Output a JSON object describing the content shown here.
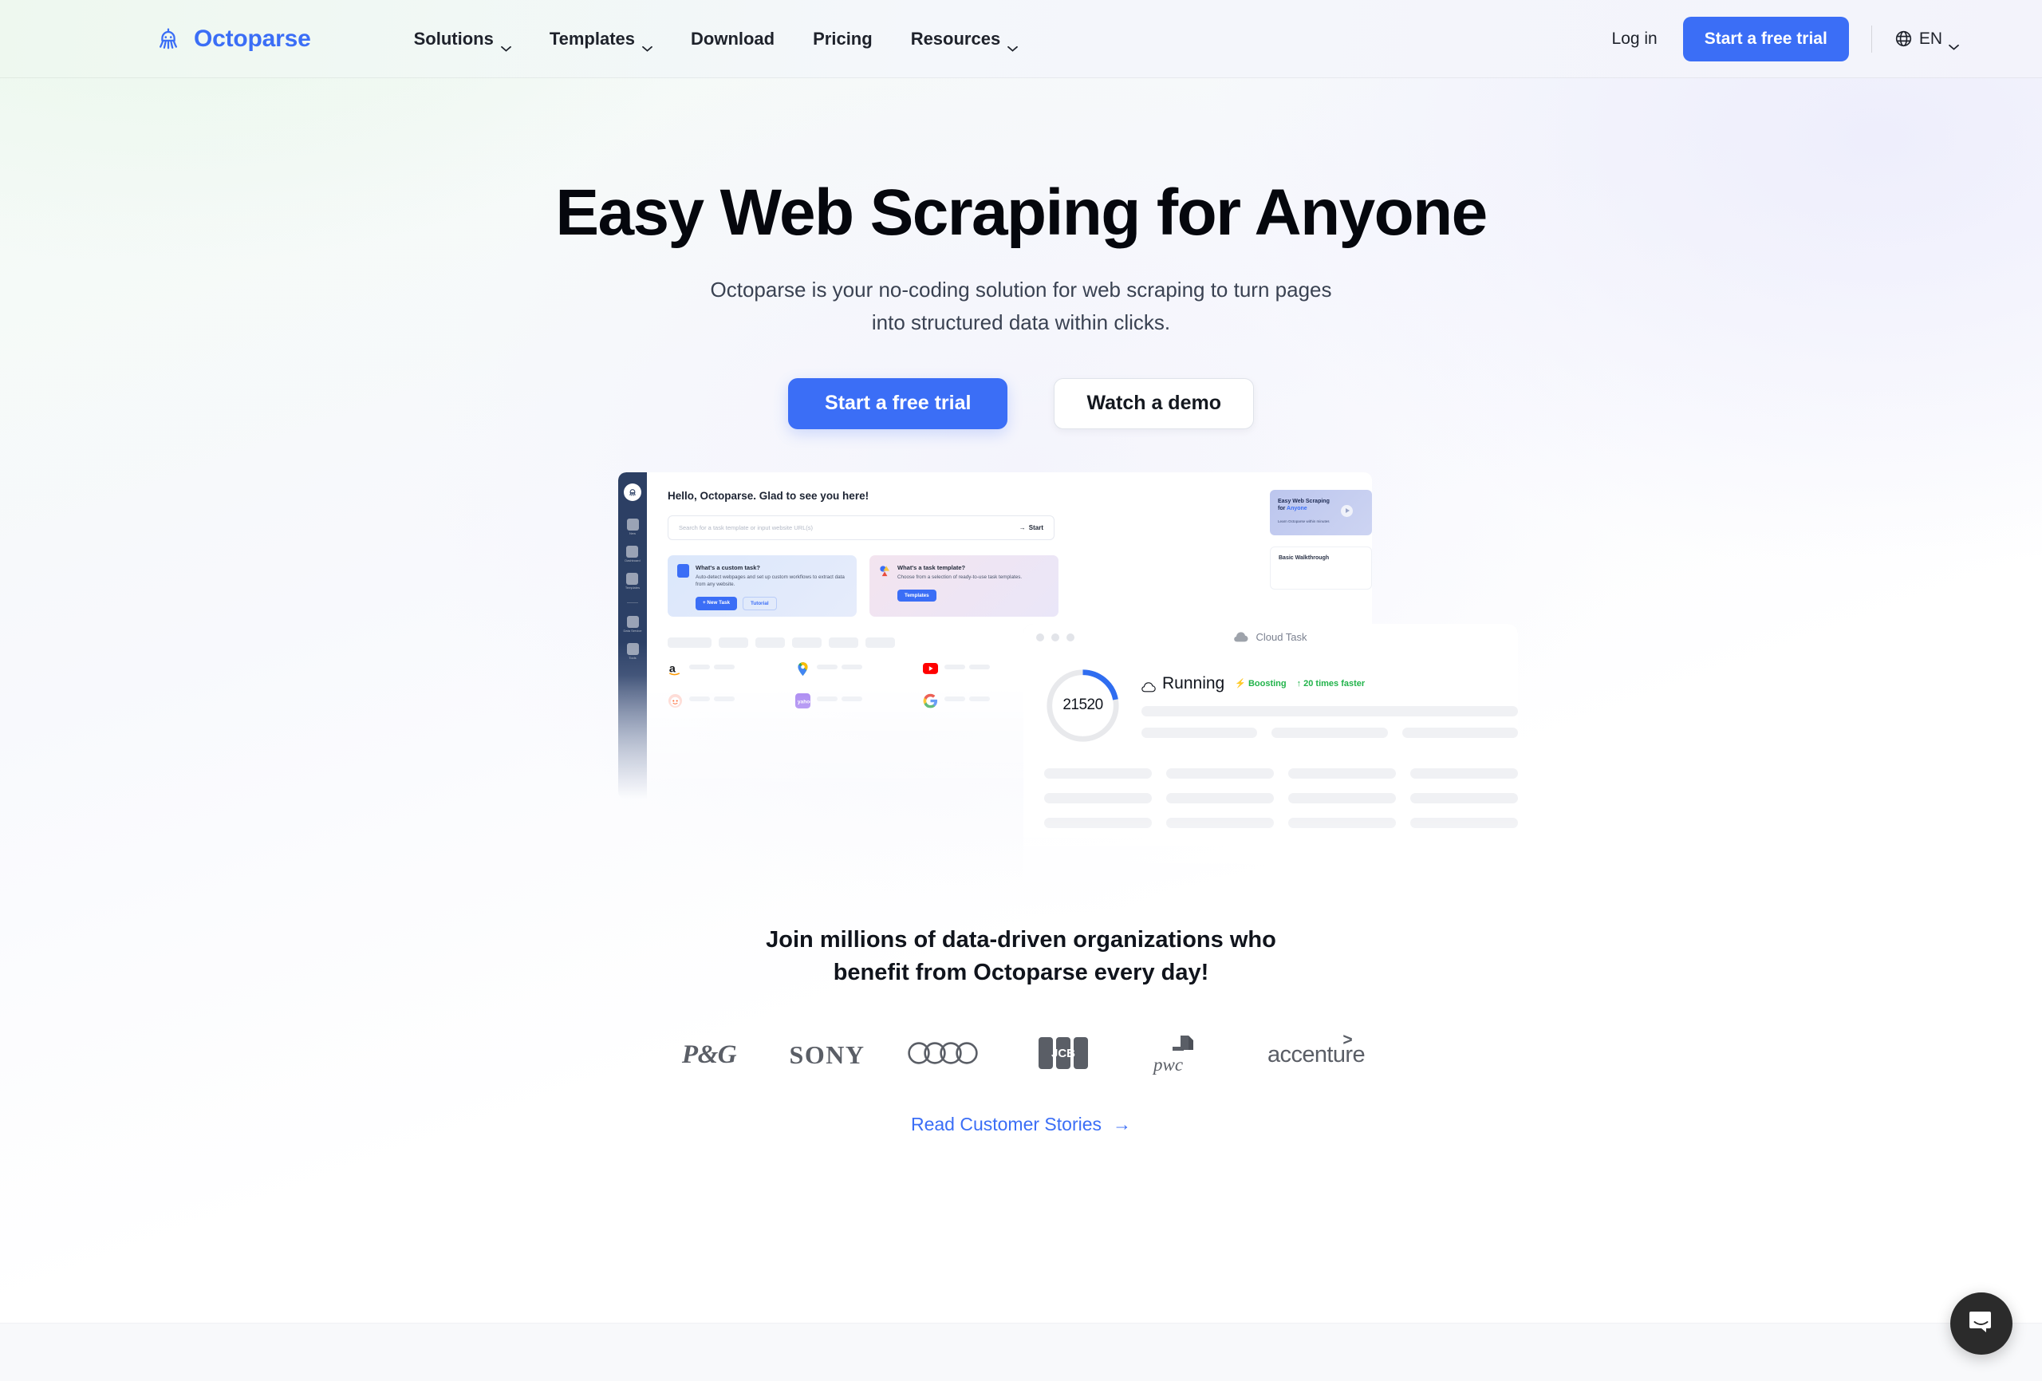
{
  "brand": {
    "name": "Octoparse",
    "icon": "octopus-logo-icon",
    "accent": "#3b6ef6"
  },
  "nav": {
    "items": [
      {
        "label": "Solutions",
        "has_dropdown": true
      },
      {
        "label": "Templates",
        "has_dropdown": true
      },
      {
        "label": "Download",
        "has_dropdown": false
      },
      {
        "label": "Pricing",
        "has_dropdown": false
      },
      {
        "label": "Resources",
        "has_dropdown": true
      }
    ],
    "login_label": "Log in",
    "trial_label": "Start a free trial",
    "language": "EN",
    "language_icon": "globe-icon"
  },
  "hero": {
    "heading": "Easy Web Scraping for Anyone",
    "subtitle_line1": "Octoparse is your no-coding solution for web scraping to turn pages",
    "subtitle_line2": "into structured data within clicks.",
    "primary_cta": "Start a free trial",
    "secondary_cta": "Watch a demo"
  },
  "mockup": {
    "sidebar": {
      "items": [
        {
          "label": "New",
          "icon": "plus-square-icon"
        },
        {
          "label": "Dashboard",
          "icon": "bookmark-icon"
        },
        {
          "label": "Templates",
          "icon": "templates-icon"
        },
        {
          "label": "Data Service",
          "icon": "diamond-icon"
        },
        {
          "label": "Tools",
          "icon": "briefcase-icon"
        }
      ]
    },
    "greeting": "Hello, Octoparse. Glad to see you here!",
    "search": {
      "placeholder": "Search for a task template or input website URL(s)",
      "start_label": "Start"
    },
    "cards": [
      {
        "title": "What's a custom task?",
        "desc": "Auto-detect webpages and set up custom workflows to extract data from any website.",
        "primary_btn": "+ New Task",
        "secondary_btn": "Tutorial",
        "icon": "custom-task-icon"
      },
      {
        "title": "What's a task template?",
        "desc": "Choose from a selection of ready-to-use task templates.",
        "primary_btn": "Templates",
        "icon": "task-template-icon"
      }
    ],
    "template_sites": [
      "amazon",
      "google-maps",
      "youtube",
      "reddit",
      "yahoo",
      "google"
    ],
    "promo": {
      "title_line1": "Easy Web Scraping",
      "title_prefix2": "for ",
      "title_highlight": "Anyone",
      "subtitle": "Learn Octoparse within minutes",
      "play_icon": "play-icon",
      "walkthrough_title": "Basic Walkthrough"
    },
    "cloud_panel": {
      "title": "Cloud Task",
      "title_icon": "cloud-icon",
      "counter_main": "21",
      "counter_sub": "520",
      "progress_percent": 22,
      "status": "Running",
      "status_icon": "cloud-icon",
      "badge_boosting": "Boosting",
      "badge_boosting_icon": "bolt-icon",
      "badge_speed": "20 times faster",
      "badge_speed_icon": "arrow-up-icon",
      "badge_color": "#21b34a"
    }
  },
  "social_proof": {
    "heading_line1": "Join millions of data-driven organizations who",
    "heading_line2": "benefit from Octoparse every day!",
    "logos": [
      {
        "name": "P&G",
        "type": "pg"
      },
      {
        "name": "SONY",
        "type": "sony"
      },
      {
        "name": "Audi",
        "type": "audi"
      },
      {
        "name": "JCB",
        "type": "jcb"
      },
      {
        "name": "pwc",
        "type": "pwc"
      },
      {
        "name": "accenture",
        "type": "accenture"
      }
    ],
    "stories_link": "Read Customer Stories",
    "stories_arrow": "→"
  },
  "chat": {
    "icon": "chat-bubble-icon",
    "label": "Open chat"
  }
}
